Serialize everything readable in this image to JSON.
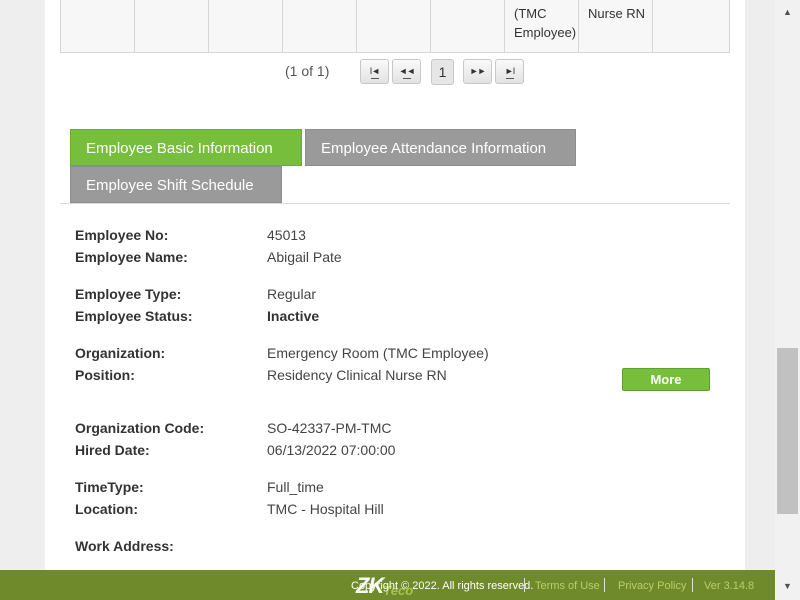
{
  "table": {
    "cells": [
      "",
      "",
      "",
      "",
      "",
      "",
      "(TMC Employee)",
      "Nurse RN",
      ""
    ]
  },
  "pager": {
    "info": "(1 of 1)",
    "first": "I◄",
    "prev": "◄◄",
    "page": "1",
    "next": "►►",
    "last": "►I"
  },
  "tabs": {
    "basic": "Employee Basic Information",
    "attendance": "Employee Attendance Information",
    "shift": "Employee Shift Schedule"
  },
  "employee": {
    "no_label": "Employee No:",
    "no": "45013",
    "name_label": "Employee Name:",
    "name": "Abigail Pate",
    "type_label": "Employee Type:",
    "type": "Regular",
    "status_label": "Employee Status:",
    "status": "Inactive",
    "org_label": "Organization:",
    "org": "Emergency Room (TMC Employee)",
    "position_label": "Position:",
    "position": "Residency Clinical Nurse RN",
    "org_code_label": "Organization Code:",
    "org_code": "SO-42337-PM-TMC",
    "hired_label": "Hired Date:",
    "hired": "06/13/2022 07:00:00",
    "timetype_label": "TimeType:",
    "timetype": "Full_time",
    "location_label": "Location:",
    "location": "TMC - Hospital Hill",
    "work_address_label": "Work Address:"
  },
  "more_button": "More",
  "footer": {
    "logo_main": "ZK",
    "logo_sub": "Teco",
    "copyright": "Copyright © 2022. All rights reserved.",
    "terms": "Terms of Use",
    "privacy": "Privacy Policy",
    "version": "Ver 3.14.8"
  },
  "colors": {
    "accent_green": "#76be3b",
    "tab_gray": "#9a9a9a",
    "footer_bg": "#6f8a2b"
  }
}
